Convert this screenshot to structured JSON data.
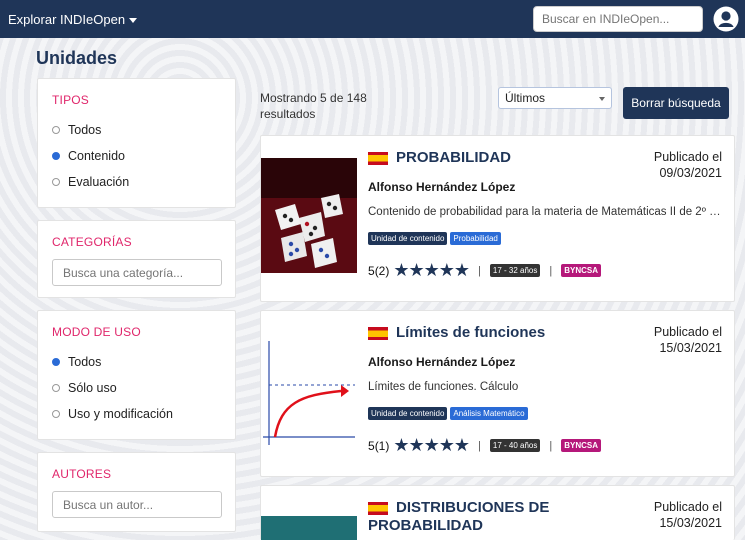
{
  "topbar": {
    "explore_label": "Explorar INDIeOpen",
    "search_placeholder": "Buscar en INDIeOpen..."
  },
  "page_title": "Unidades",
  "filters": {
    "types": {
      "title": "TIPOS",
      "options": [
        "Todos",
        "Contenido",
        "Evaluación"
      ],
      "selected": "Contenido"
    },
    "categories": {
      "title": "CATEGORÍAS",
      "placeholder": "Busca una categoría..."
    },
    "usage": {
      "title": "MODO DE USO",
      "options": [
        "Todos",
        "Sólo uso",
        "Uso y modificación"
      ],
      "selected": "Todos"
    },
    "authors": {
      "title": "AUTORES",
      "placeholder": "Busca un autor..."
    }
  },
  "results": {
    "showing_text": "Mostrando 5 de 148 resultados",
    "sort_value": "Últimos",
    "clear_label": "Borrar búsqueda"
  },
  "cards": [
    {
      "title": "PROBABILIDAD",
      "published_label": "Publicado el",
      "published_date": "09/03/2021",
      "author": "Alfonso Hernández López",
      "description": "Contenido de probabilidad para la materia de Matemáticas II de 2º de...",
      "tags": [
        "Unidad de contenido",
        "Probabilidad"
      ],
      "rating": "5",
      "rating_count": "(2)",
      "stars": "★★★★★",
      "age": "17 - 32 años",
      "license": "BYNCSA"
    },
    {
      "title": "Límites de funciones",
      "published_label": "Publicado el",
      "published_date": "15/03/2021",
      "author": "Alfonso Hernández López",
      "description": "Límites de funciones. Cálculo",
      "tags": [
        "Unidad de contenido",
        "Análisis Matemático"
      ],
      "rating": "5",
      "rating_count": "(1)",
      "stars": "★★★★★",
      "age": "17 - 40 años",
      "license": "BYNCSA"
    },
    {
      "title": "DISTRIBUCIONES DE PROBABILIDAD",
      "published_label": "Publicado el",
      "published_date": "15/03/2021"
    }
  ],
  "colors": {
    "navy": "#1f3558",
    "accent_pink": "#e0266b",
    "tag_blue": "#2a6bd6",
    "license_magenta": "#b5187a"
  }
}
